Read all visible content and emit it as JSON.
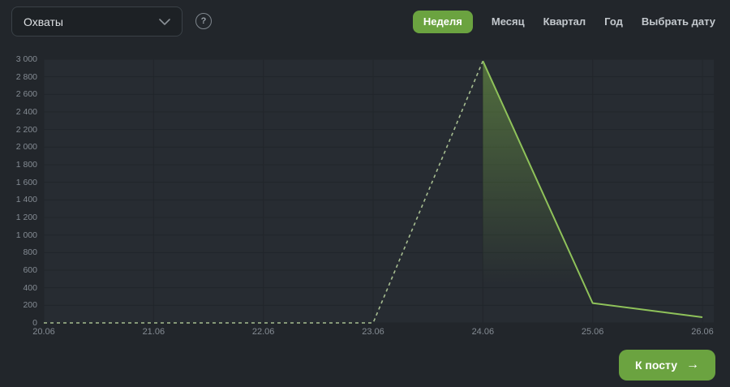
{
  "header": {
    "metric_dropdown": {
      "value": "Охваты"
    },
    "help_icon_glyph": "?",
    "period_tabs": [
      {
        "id": "week",
        "label": "Неделя",
        "active": true
      },
      {
        "id": "month",
        "label": "Месяц",
        "active": false
      },
      {
        "id": "quarter",
        "label": "Квартал",
        "active": false
      },
      {
        "id": "year",
        "label": "Год",
        "active": false
      },
      {
        "id": "pick-date",
        "label": "Выбрать дату",
        "active": false
      }
    ]
  },
  "chart_data": {
    "type": "area",
    "title": "",
    "xlabel": "",
    "ylabel": "",
    "categories": [
      "20.06",
      "21.06",
      "22.06",
      "23.06",
      "24.06",
      "25.06",
      "26.06"
    ],
    "series": [
      {
        "name": "Охваты",
        "values": [
          0,
          0,
          0,
          0,
          2980,
          225,
          65
        ]
      }
    ],
    "ylim": [
      0,
      3000
    ],
    "y_tick_step": 200,
    "grid": true,
    "legend": "none",
    "style": {
      "dashed_from_index": 0,
      "dashed_to_index": 4,
      "solid_from_index": 4,
      "solid_to_index": 6,
      "fill_under_solid_segment": true
    },
    "colors": {
      "solid_line": "#8fc25a",
      "dashed_line": "#a6bd90",
      "fill_top": "rgba(124,176,74,0.50)",
      "fill_bottom": "rgba(124,176,74,0)",
      "grid_line": "#21262b",
      "plot_bg": "#272c32",
      "page_bg": "#22262b",
      "axis_label": "#848b93"
    }
  },
  "footer": {
    "post_button": {
      "label": "К посту",
      "arrow": "→"
    }
  },
  "accent_color": "#6ba340"
}
